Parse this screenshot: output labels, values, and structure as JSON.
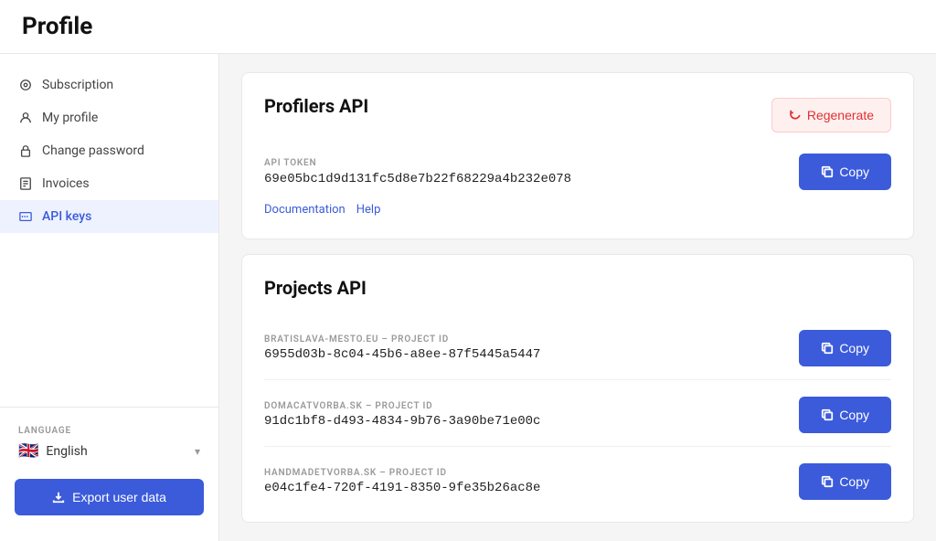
{
  "page": {
    "title": "Profile"
  },
  "sidebar": {
    "items": [
      {
        "id": "subscription",
        "label": "Subscription",
        "icon": "⊙",
        "active": false
      },
      {
        "id": "my-profile",
        "label": "My profile",
        "icon": "👤",
        "active": false
      },
      {
        "id": "change-password",
        "label": "Change password",
        "icon": "🔒",
        "active": false
      },
      {
        "id": "invoices",
        "label": "Invoices",
        "icon": "📋",
        "active": false
      },
      {
        "id": "api-keys",
        "label": "API keys",
        "icon": "📄",
        "active": true
      }
    ],
    "language": {
      "label": "LANGUAGE",
      "flag": "🇬🇧",
      "name": "English"
    },
    "export_button": "Export user data"
  },
  "profilers_api": {
    "title": "Profilers API",
    "regenerate_label": "Regenerate",
    "token": {
      "label": "API TOKEN",
      "value": "69e05bc1d9d131fc5d8e7b22f68229a4b232e078",
      "copy_label": "Copy"
    },
    "links": [
      {
        "label": "Documentation"
      },
      {
        "label": "Help"
      }
    ]
  },
  "projects_api": {
    "title": "Projects API",
    "projects": [
      {
        "label": "BRATISLAVA-MESTO.EU – PROJECT ID",
        "id": "6955d03b-8c04-45b6-a8ee-87f5445a5447",
        "copy_label": "Copy"
      },
      {
        "label": "DOMACATVORBA.SK – PROJECT ID",
        "id": "91dc1bf8-d493-4834-9b76-3a90be71e00c",
        "copy_label": "Copy"
      },
      {
        "label": "HANDMADETVORBA.SK – PROJECT ID",
        "id": "e04c1fe4-720f-4191-8350-9fe35b26ac8e",
        "copy_label": "Copy"
      }
    ]
  }
}
